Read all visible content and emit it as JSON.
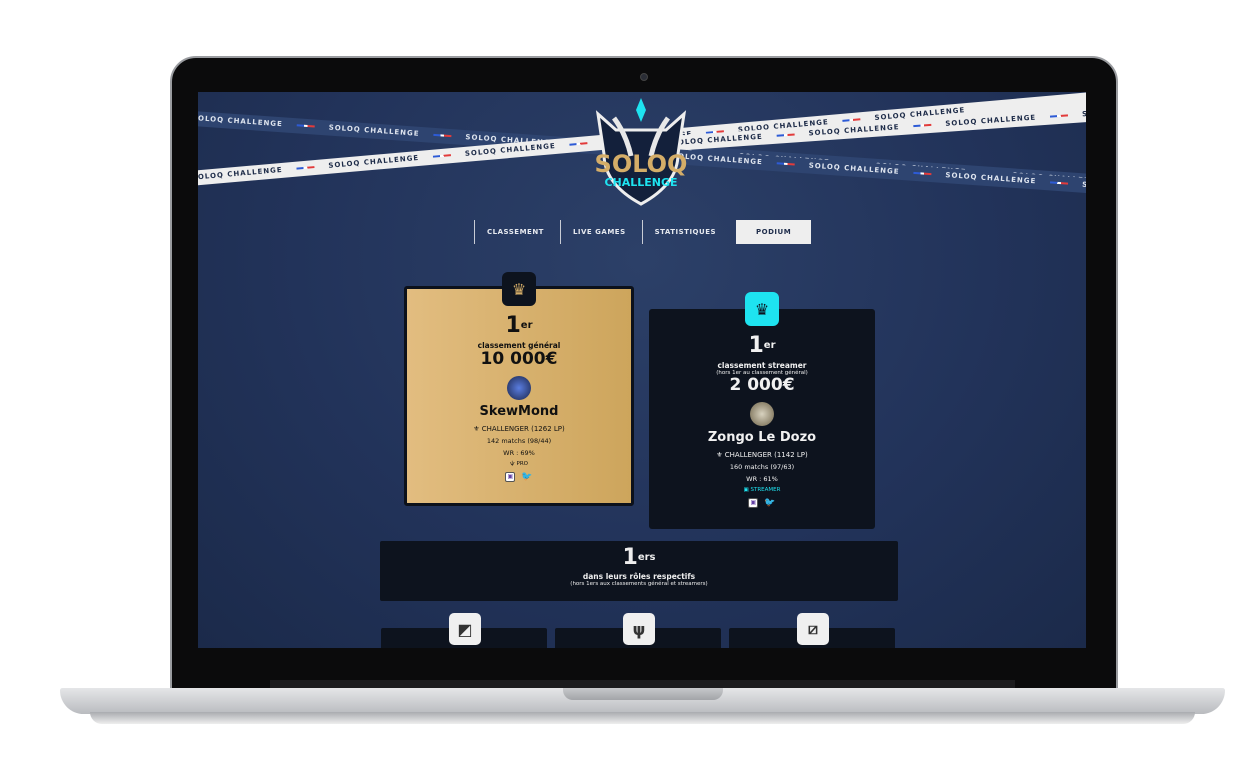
{
  "banner": {
    "text": "SOLOQ CHALLENGE"
  },
  "logo": {
    "line1": "SOLOQ",
    "line2": "CHALLENGE"
  },
  "nav": [
    {
      "label": "CLASSEMENT"
    },
    {
      "label": "LIVE GAMES"
    },
    {
      "label": "STATISTIQUES"
    },
    {
      "label": "PODIUM",
      "active": true
    }
  ],
  "general": {
    "rank": "1",
    "suffix": "er",
    "category": "classement général",
    "prize": "10 000€",
    "player": "SkewMond",
    "tier": "CHALLENGER (1262 LP)",
    "matches": "142 matchs (98/44)",
    "wr": "WR : 69%",
    "tag": "PRO"
  },
  "streamer": {
    "rank": "1",
    "suffix": "er",
    "category": "classement streamer",
    "note": "(hors 1er au classement général)",
    "prize": "2 000€",
    "player": "Zongo Le Dozo",
    "tier": "CHALLENGER (1142 LP)",
    "matches": "160 matchs (97/63)",
    "wr": "WR : 61%",
    "tag": "STREAMER"
  },
  "roles": {
    "rank": "1",
    "suffix": "ers",
    "title": "dans leurs rôles respectifs",
    "note": "(hors 1ers aux classements général et streamers)"
  },
  "colors": {
    "gold": "#d4ad68",
    "cyan": "#1ee3f0",
    "bg": "#22335a",
    "card": "#0d131e"
  }
}
